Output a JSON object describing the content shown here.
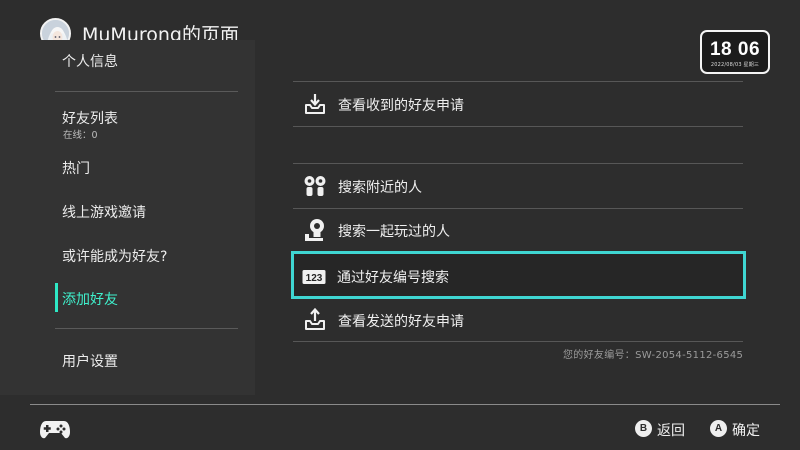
{
  "header": {
    "title": "MuMurong的页面",
    "clock_time": "18 06",
    "clock_date": "2022/08/03  星期三"
  },
  "sidebar": {
    "items": [
      {
        "label": "个人信息"
      },
      {
        "label": "好友列表",
        "sub": "在线：0"
      },
      {
        "label": "热门"
      },
      {
        "label": "线上游戏邀请"
      },
      {
        "label": "或许能成为好友?"
      },
      {
        "label": "添加好友",
        "selected": true
      },
      {
        "label": "用户设置"
      }
    ]
  },
  "main": {
    "items": [
      {
        "label": "查看收到的好友申请",
        "icon": "inbox-download-icon"
      },
      {
        "label": "搜索附近的人",
        "icon": "nearby-users-icon"
      },
      {
        "label": "搜索一起玩过的人",
        "icon": "played-with-icon"
      },
      {
        "label": "通过好友编号搜索",
        "icon": "number-123-icon",
        "selected": true
      },
      {
        "label": "查看发送的好友申请",
        "icon": "outbox-upload-icon"
      }
    ],
    "friend_code": "您的好友编号：SW-2054-5112-6545"
  },
  "footer": {
    "back_key": "B",
    "back_label": "返回",
    "ok_key": "A",
    "ok_label": "确定"
  },
  "colors": {
    "background": "#2d2d2d",
    "sidebar": "#333333",
    "accent_teal": "#2ee8c5",
    "selection_border": "#3fd6d2",
    "controller_dot_active": "#42e35c"
  }
}
